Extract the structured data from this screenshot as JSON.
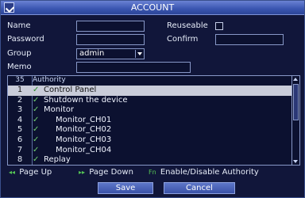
{
  "window": {
    "title": "ACCOUNT"
  },
  "form": {
    "name_label": "Name",
    "name_value": "",
    "reuseable_label": "Reuseable",
    "password_label": "Password",
    "password_value": "",
    "confirm_label": "Confirm",
    "confirm_value": "",
    "group_label": "Group",
    "group_value": "admin",
    "memo_label": "Memo",
    "memo_value": ""
  },
  "authority": {
    "count": "35",
    "header": "Authority",
    "rows": [
      {
        "idx": "1",
        "name": "Control Panel"
      },
      {
        "idx": "2",
        "name": "Shutdown the device"
      },
      {
        "idx": "3",
        "name": "Monitor"
      },
      {
        "idx": "4",
        "name": "Monitor_CH01"
      },
      {
        "idx": "5",
        "name": "Monitor_CH02"
      },
      {
        "idx": "6",
        "name": "Monitor_CH03"
      },
      {
        "idx": "7",
        "name": "Monitor_CH04"
      },
      {
        "idx": "8",
        "name": "Replay"
      }
    ],
    "check_glyph": "✓"
  },
  "hints": {
    "page_up_key": "◂◂",
    "page_up": "Page Up",
    "page_down_key": "▸▸",
    "page_down": "Page Down",
    "toggle_key": "Fn",
    "toggle": "Enable/Disable Authority"
  },
  "buttons": {
    "save": "Save",
    "cancel": "Cancel"
  }
}
